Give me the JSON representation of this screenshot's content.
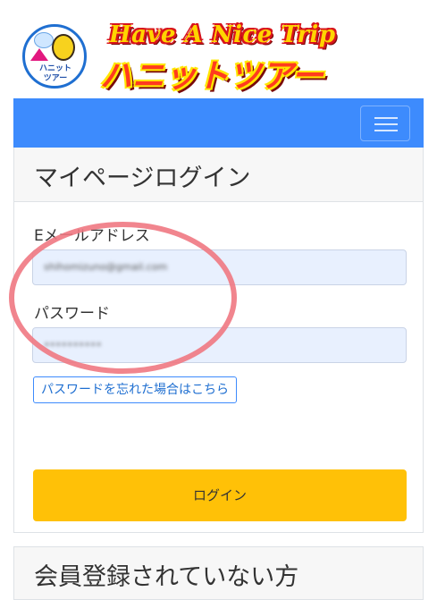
{
  "brand": {
    "name_en": "Have A Nice Trip",
    "name_ja": "ハニットツアー",
    "logo_text": "ハニット\nツアー"
  },
  "navbar": {
    "menu_icon": "hamburger-icon",
    "color": "#3d8bfd"
  },
  "login_card": {
    "title": "マイページログイン",
    "email_label": "Eメールアドレス",
    "email_value": "shihomizuno@gmail.com",
    "password_label": "パスワード",
    "password_value": "••••••••••",
    "forgot_label": "パスワードを忘れた場合はこちら",
    "login_label": "ログイン",
    "login_color": "#ffc107"
  },
  "register_card": {
    "title": "会員登録されていない方"
  },
  "annotation": {
    "color": "#f07882"
  }
}
